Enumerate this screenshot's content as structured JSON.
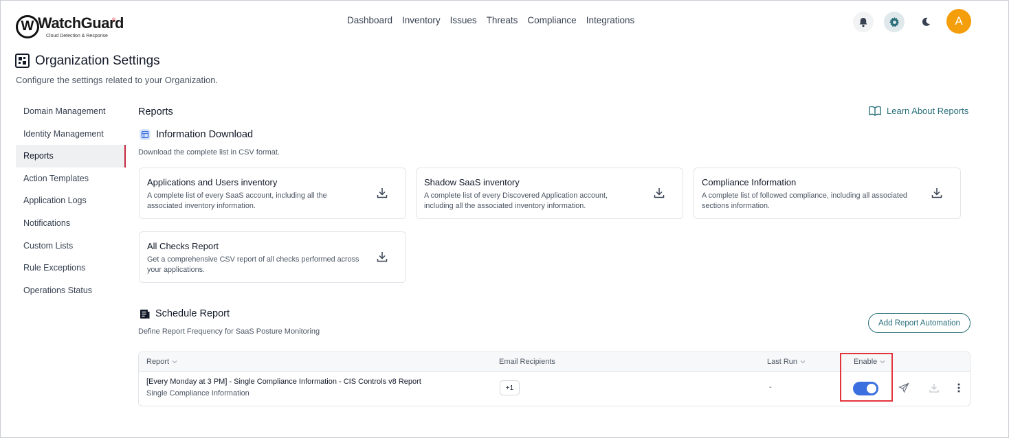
{
  "header": {
    "logo_text": "WatchGuard",
    "logo_sub": "Cloud Detection & Response",
    "nav": [
      "Dashboard",
      "Inventory",
      "Issues",
      "Threats",
      "Compliance",
      "Integrations"
    ],
    "avatar_initial": "A"
  },
  "page": {
    "title": "Organization Settings",
    "subtitle": "Configure the settings related to your Organization."
  },
  "sidebar": {
    "items": [
      {
        "label": "Domain Management",
        "active": false
      },
      {
        "label": "Identity Management",
        "active": false
      },
      {
        "label": "Reports",
        "active": true
      },
      {
        "label": "Action Templates",
        "active": false
      },
      {
        "label": "Application Logs",
        "active": false
      },
      {
        "label": "Notifications",
        "active": false
      },
      {
        "label": "Custom Lists",
        "active": false
      },
      {
        "label": "Rule Exceptions",
        "active": false
      },
      {
        "label": "Operations Status",
        "active": false
      }
    ]
  },
  "main": {
    "section_title": "Reports",
    "learn_link": "Learn About Reports",
    "download": {
      "title": "Information Download",
      "description": "Download the complete list in CSV format.",
      "cards": [
        {
          "title": "Applications and Users inventory",
          "description": "A complete list of every SaaS account, including all the associated inventory information."
        },
        {
          "title": "Shadow SaaS inventory",
          "description": "A complete list of every Discovered Application account, including all the associated inventory information."
        },
        {
          "title": "Compliance Information",
          "description": "A complete list of followed compliance, including all associated sections information."
        },
        {
          "title": "All Checks Report",
          "description": "Get a comprehensive CSV report of all checks performed across your applications."
        }
      ]
    },
    "schedule": {
      "title": "Schedule Report",
      "description": "Define Report Frequency for SaaS Posture Monitoring",
      "add_button": "Add Report Automation",
      "columns": {
        "report": "Report",
        "email": "Email Recipients",
        "last_run": "Last Run",
        "enable": "Enable"
      },
      "rows": [
        {
          "name": "[Every Monday at 3 PM] - Single Compliance Information - CIS Controls v8 Report",
          "type": "Single Compliance Information",
          "recipients": "+1",
          "last_run": "-",
          "enabled": true
        }
      ]
    }
  },
  "colors": {
    "accent": "#2a6f7a",
    "toggle_on": "#3b6fe0",
    "avatar": "#f59e0b",
    "active_marker": "#c5283d",
    "highlight": "#e3343c"
  }
}
